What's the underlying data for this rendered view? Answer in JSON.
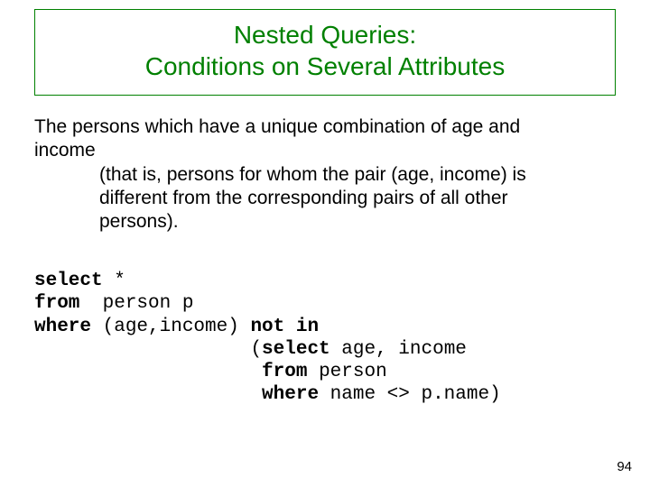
{
  "title": {
    "line1": "Nested Queries:",
    "line2": "Conditions on Several Attributes"
  },
  "body": {
    "intro1": "The persons which have a unique combination of age and",
    "intro2": "income",
    "paren1": "(that is, persons for whom the pair (age, income) is",
    "paren2": "different from the corresponding pairs of all other",
    "paren3": "persons)."
  },
  "sql": {
    "kw_select": "select",
    "star": " *",
    "kw_from": "from",
    "from_rest": "  person p",
    "kw_where": "where",
    "where_tuple": " (age,income) ",
    "kw_notin": "not in",
    "sub_open_pad": "                   (",
    "kw_select2": "select",
    "sub_select_rest": " age, income",
    "sub_from_pad": "                    ",
    "kw_from2": "from",
    "sub_from_rest": " person",
    "sub_where_pad": "                    ",
    "kw_where2": "where",
    "sub_where_rest": " name <> p.name)"
  },
  "page_number": "94"
}
